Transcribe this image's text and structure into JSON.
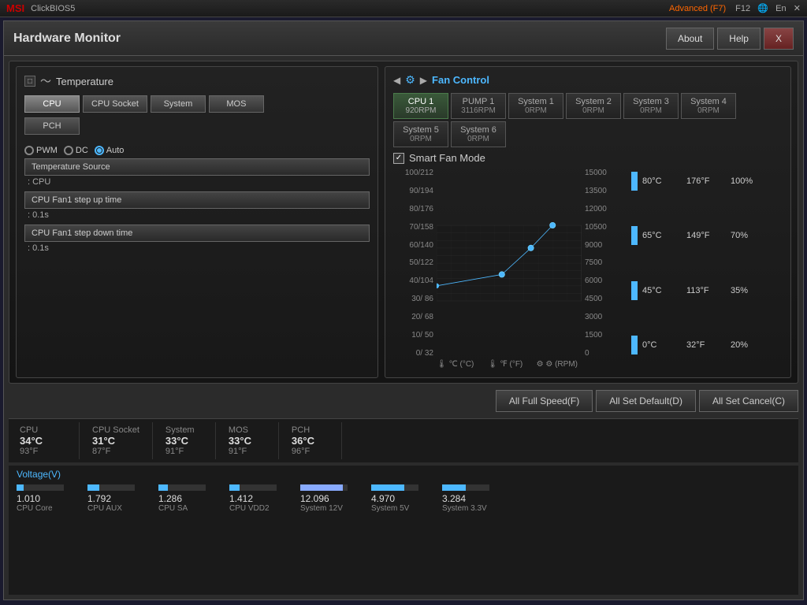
{
  "topbar": {
    "logo": "MSI",
    "title": "ClickBIOS5",
    "advanced": "Advanced (F7)",
    "close": "✕"
  },
  "window": {
    "title": "Hardware Monitor",
    "btn_about": "About",
    "btn_help": "Help",
    "btn_close": "X"
  },
  "temperature": {
    "section_title": "Temperature",
    "buttons": [
      {
        "label": "CPU",
        "active": true
      },
      {
        "label": "CPU Socket",
        "active": false
      },
      {
        "label": "System",
        "active": false
      },
      {
        "label": "MOS",
        "active": false
      },
      {
        "label": "PCH",
        "active": false
      }
    ]
  },
  "fan_control": {
    "section_title": "Fan Control",
    "tabs": [
      {
        "label": "CPU 1",
        "rpm": "920RPM",
        "active": true
      },
      {
        "label": "PUMP 1",
        "rpm": "3116RPM",
        "active": false
      },
      {
        "label": "System 1",
        "rpm": "0RPM",
        "active": false
      },
      {
        "label": "System 2",
        "rpm": "0RPM",
        "active": false
      },
      {
        "label": "System 3",
        "rpm": "0RPM",
        "active": false
      },
      {
        "label": "System 4",
        "rpm": "0RPM",
        "active": false
      },
      {
        "label": "System 5",
        "rpm": "0RPM",
        "active": false
      },
      {
        "label": "System 6",
        "rpm": "0RPM",
        "active": false
      }
    ]
  },
  "smart_fan": {
    "title": "Smart Fan Mode",
    "checkbox": "✓",
    "modes": [
      {
        "label": "PWM",
        "checked": false
      },
      {
        "label": "DC",
        "checked": false
      },
      {
        "label": "Auto",
        "checked": true
      }
    ],
    "temp_source_btn": "Temperature Source",
    "temp_source_value": ": CPU",
    "step_up_btn": "CPU Fan1 step up time",
    "step_up_value": ": 0.1s",
    "step_down_btn": "CPU Fan1 step down time",
    "step_down_value": ": 0.1s"
  },
  "chart": {
    "y_left": [
      "100/212",
      "90/194",
      "80/176",
      "70/158",
      "60/140",
      "50/122",
      "40/104",
      "30/ 86",
      "20/ 68",
      "10/ 50",
      "0/ 32"
    ],
    "y_right": [
      "15000",
      "13500",
      "12000",
      "10500",
      "9000",
      "7500",
      "6000",
      "4500",
      "3000",
      "1500",
      "0"
    ],
    "legend": [
      {
        "temp_c": "80°C",
        "temp_f": "176°F",
        "pct": "100%"
      },
      {
        "temp_c": "65°C",
        "temp_f": "149°F",
        "pct": "70%"
      },
      {
        "temp_c": "45°C",
        "temp_f": "113°F",
        "pct": "35%"
      },
      {
        "temp_c": "0°C",
        "temp_f": "32°F",
        "pct": "20%"
      }
    ],
    "x_label_celsius": "℃ (°C)",
    "x_label_fahrenheit": "℉ (°F)",
    "x_label_rpm": "⚙ (RPM)"
  },
  "buttons": {
    "all_full_speed": "All Full Speed(F)",
    "all_set_default": "All Set Default(D)",
    "all_set_cancel": "All Set Cancel(C)"
  },
  "temp_readouts": [
    {
      "label": "CPU",
      "c": "34°C",
      "f": "93°F"
    },
    {
      "label": "CPU Socket",
      "c": "31°C",
      "f": "87°F"
    },
    {
      "label": "System",
      "c": "33°C",
      "f": "91°F"
    },
    {
      "label": "MOS",
      "c": "33°C",
      "f": "91°F"
    },
    {
      "label": "PCH",
      "c": "36°C",
      "f": "96°F"
    }
  ],
  "voltage": {
    "header": "Voltage(V)",
    "items": [
      {
        "label": "CPU Core",
        "value": "1.010",
        "fill_pct": 15,
        "highlight": false
      },
      {
        "label": "CPU AUX",
        "value": "1.792",
        "fill_pct": 25,
        "highlight": false
      },
      {
        "label": "CPU SA",
        "value": "1.286",
        "fill_pct": 20,
        "highlight": false
      },
      {
        "label": "CPU VDD2",
        "value": "1.412",
        "fill_pct": 22,
        "highlight": false
      },
      {
        "label": "System 12V",
        "value": "12.096",
        "fill_pct": 90,
        "highlight": true
      },
      {
        "label": "System 5V",
        "value": "4.970",
        "fill_pct": 70,
        "highlight": false
      },
      {
        "label": "System 3.3V",
        "value": "3.284",
        "fill_pct": 50,
        "highlight": false
      }
    ]
  }
}
